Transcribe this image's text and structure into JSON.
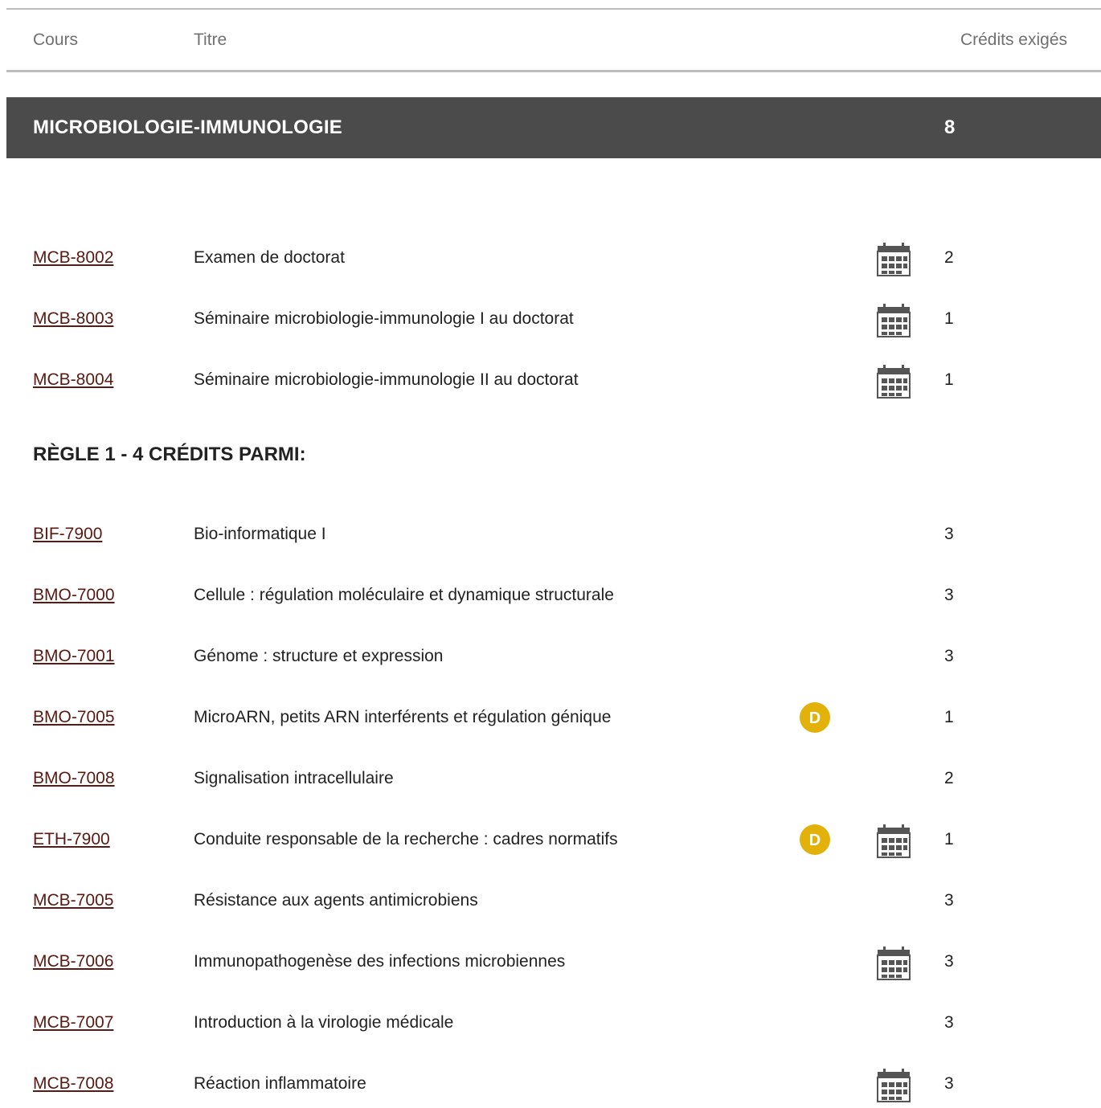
{
  "header": {
    "cours": "Cours",
    "titre": "Titre",
    "credits": "Crédits exigés"
  },
  "section": {
    "title": "MICROBIOLOGIE-IMMUNOLOGIE",
    "credits": "8"
  },
  "mandatory_courses": [
    {
      "code": "MCB-8002",
      "title": "Examen de doctorat",
      "credits": "2",
      "badge": "",
      "schedule_icon": "calendar-icon"
    },
    {
      "code": "MCB-8003",
      "title": "Séminaire microbiologie-immunologie I au doctorat",
      "credits": "1",
      "badge": "",
      "schedule_icon": "calendar-icon"
    },
    {
      "code": "MCB-8004",
      "title": "Séminaire microbiologie-immunologie II au doctorat",
      "credits": "1",
      "badge": "",
      "schedule_icon": "calendar-icon"
    }
  ],
  "rule": {
    "title": "RÈGLE 1 - 4 CRÉDITS PARMI:"
  },
  "rule_courses": [
    {
      "code": "BIF-7900",
      "title": "Bio-informatique I",
      "credits": "3",
      "badge": "",
      "schedule_icon": ""
    },
    {
      "code": "BMO-7000",
      "title": "Cellule : régulation moléculaire et dynamique structurale",
      "credits": "3",
      "badge": "",
      "schedule_icon": ""
    },
    {
      "code": "BMO-7001",
      "title": "Génome : structure et expression",
      "credits": "3",
      "badge": "",
      "schedule_icon": ""
    },
    {
      "code": "BMO-7005",
      "title": "MicroARN, petits ARN interférents et régulation génique",
      "credits": "1",
      "badge": "D",
      "schedule_icon": ""
    },
    {
      "code": "BMO-7008",
      "title": "Signalisation intracellulaire",
      "credits": "2",
      "badge": "",
      "schedule_icon": ""
    },
    {
      "code": "ETH-7900",
      "title": "Conduite responsable de la recherche : cadres normatifs",
      "credits": "1",
      "badge": "D",
      "schedule_icon": "calendar-icon"
    },
    {
      "code": "MCB-7005",
      "title": "Résistance aux agents antimicrobiens",
      "credits": "3",
      "badge": "",
      "schedule_icon": ""
    },
    {
      "code": "MCB-7006",
      "title": "Immunopathogenèse des infections microbiennes",
      "credits": "3",
      "badge": "",
      "schedule_icon": "calendar-icon"
    },
    {
      "code": "MCB-7007",
      "title": "Introduction à la virologie médicale",
      "credits": "3",
      "badge": "",
      "schedule_icon": ""
    },
    {
      "code": "MCB-7008",
      "title": "Réaction inflammatoire",
      "credits": "3",
      "badge": "",
      "schedule_icon": "calendar-icon"
    }
  ],
  "colors": {
    "section_bar": "#4b4b4b",
    "link": "#5a1a12",
    "badge": "#e2b10a",
    "calendar": "#555555"
  }
}
